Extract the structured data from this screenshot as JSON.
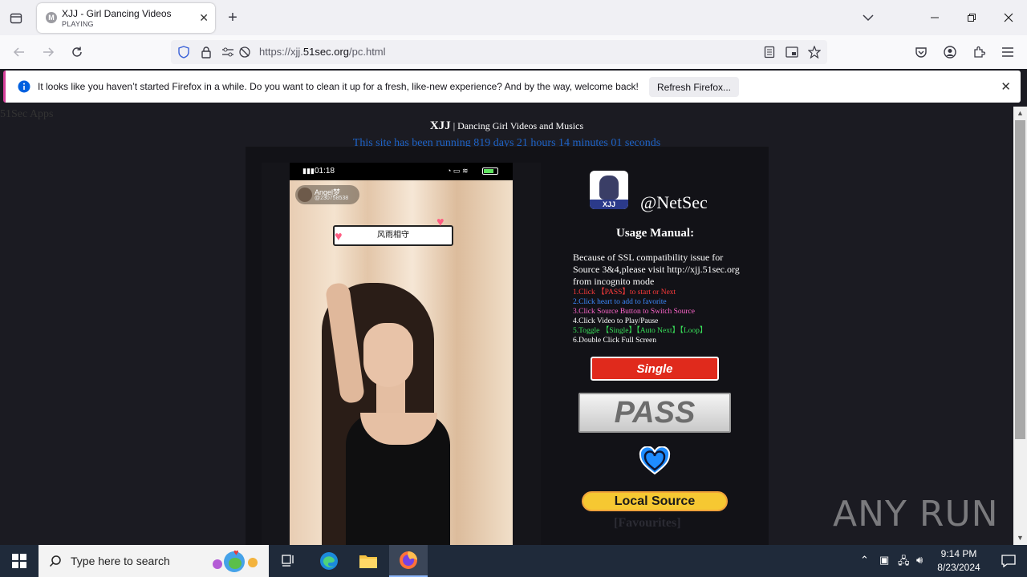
{
  "browser": {
    "tab": {
      "favicon": "M",
      "title": "XJJ - Girl Dancing Videos",
      "status": "PLAYING"
    },
    "url": {
      "prefix": "https://xjj.",
      "domain": "51sec.org",
      "path": "/pc.html"
    },
    "infobar": {
      "message": "It looks like you haven’t started Firefox in a while. Do you want to clean it up for a fresh, like-new experience? And by the way, welcome back!",
      "button": "Refresh Firefox..."
    }
  },
  "page": {
    "apps_label": "51Sec Apps",
    "site_title_brand": "XJJ",
    "site_title_rest": " | Dancing Girl Videos and Musics",
    "uptime": "This site has been running 819 days 21 hours 14 minutes 01 seconds",
    "video": {
      "status_time": "01:18",
      "user_name": "Angel梦",
      "user_id": "@230758538",
      "bubble_text": "风雨相守"
    },
    "logo_text": "XJJ",
    "handle": "@NetSec",
    "usage_title": "Usage Manual:",
    "usage_intro": "Because of SSL compatibility issue for Source 3&4,please visit http://xjj.51sec.org from incognito mode",
    "steps": [
      {
        "text": "1.Click 【PASS】to start or Next",
        "color": "#ff3b3b"
      },
      {
        "text": "2.Click heart to add to favorite",
        "color": "#3d8bff"
      },
      {
        "text": "3.Click Source Button to Switch Source",
        "color": "#ff66cc"
      },
      {
        "text": "4.Click Video to Play/Pause",
        "color": "#ffffff"
      },
      {
        "text": "5.Toggle 【Single】【Auto Next】【Loop】",
        "color": "#39e05a"
      },
      {
        "text": "6.Double Click Full Screen",
        "color": "#ffffff"
      }
    ],
    "buttons": {
      "mode": "Single",
      "pass": "PASS",
      "source": "Local Source"
    },
    "favourites_label": "[Favourites]"
  },
  "watermark": "ANY RUN",
  "taskbar": {
    "search_placeholder": "Type here to search",
    "time": "9:14 PM",
    "date": "8/23/2024"
  },
  "colors": {
    "accent": "#0060df",
    "pass_red": "#e02a1c",
    "source_yellow": "#f6c832",
    "heart_blue": "#1e8cff"
  }
}
